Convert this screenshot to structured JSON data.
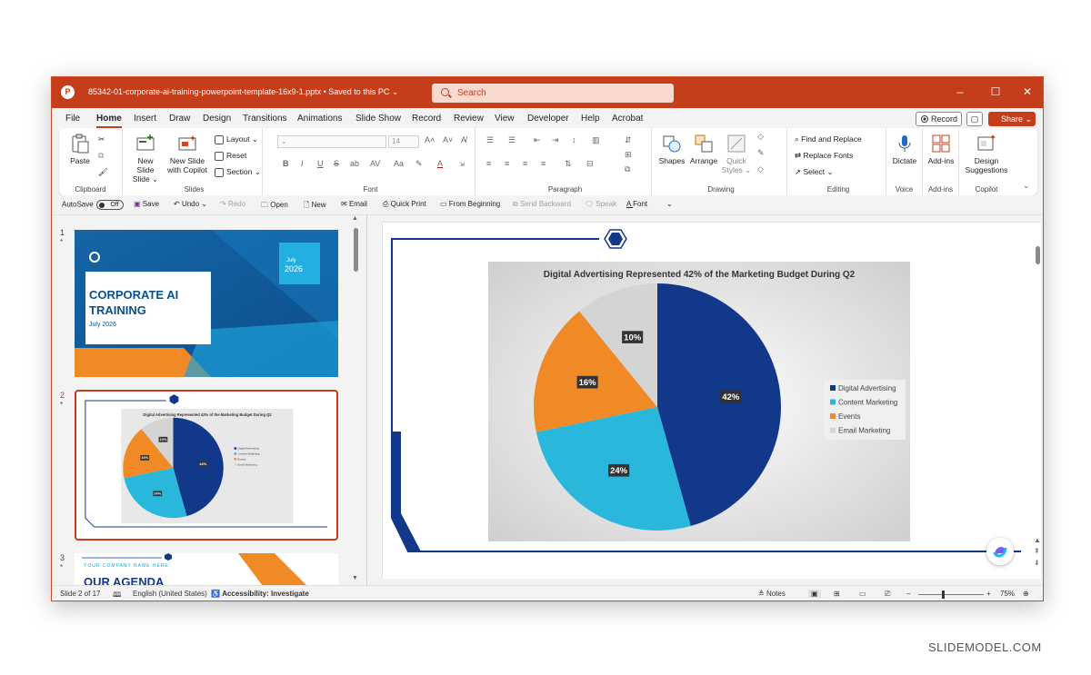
{
  "app": {
    "doc_title": "85342-01-corporate-ai-training-powerpoint-template-16x9-1.pptx • Saved to this PC ⌄",
    "search_placeholder": "Search"
  },
  "menu": {
    "tabs": [
      "File",
      "Home",
      "Insert",
      "Draw",
      "Design",
      "Transitions",
      "Animations",
      "Slide Show",
      "Record",
      "Review",
      "View",
      "Developer",
      "Help",
      "Acrobat"
    ],
    "active": "Home",
    "record_label": "Record",
    "share_label": "Share ⌄"
  },
  "ribbon": {
    "clipboard": {
      "label": "Clipboard",
      "paste": "Paste"
    },
    "slides": {
      "label": "Slides",
      "new_slide": "New Slide",
      "new_slide_copilot_1": "New Slide",
      "new_slide_copilot_2": "with Copilot",
      "layout": "Layout ⌄",
      "reset": "Reset",
      "section": "Section ⌄"
    },
    "font": {
      "label": "Font",
      "size": "14",
      "bold": "B",
      "italic": "I",
      "underline": "U",
      "strike": "S",
      "shadow": "ab",
      "spacing": "AV",
      "case": "Aa",
      "color": "A"
    },
    "paragraph": {
      "label": "Paragraph"
    },
    "drawing": {
      "label": "Drawing",
      "shapes": "Shapes",
      "arrange": "Arrange",
      "quick_styles_1": "Quick",
      "quick_styles_2": "Styles ⌄"
    },
    "editing": {
      "label": "Editing",
      "find_replace": "Find and Replace",
      "replace_fonts": "Replace Fonts",
      "select": "Select ⌄"
    },
    "voice": {
      "label": "Voice",
      "dictate": "Dictate"
    },
    "addins": {
      "label": "Add-ins",
      "addins": "Add-ins"
    },
    "copilot": {
      "label": "Copilot",
      "design_1": "Design",
      "design_2": "Suggestions"
    }
  },
  "qat": {
    "autosave": "AutoSave",
    "autosave_state": "Off",
    "save": "Save",
    "undo": "Undo",
    "redo": "Redo",
    "open": "Open",
    "new": "New",
    "email": "Email",
    "quick_print": "Quick Print",
    "from_beginning": "From Beginning",
    "send_backward": "Send Backward",
    "speak": "Speak",
    "font": "Font"
  },
  "thumbnails": {
    "slide1": {
      "num": "1",
      "title_line1": "CORPORATE AI",
      "title_line2": "TRAINING",
      "date": "July 2026",
      "badge_month": "July",
      "badge_year": "2026"
    },
    "slide2": {
      "num": "2",
      "title": "Digital Advertising Represented 42% of the Marketing Budget During Q2"
    },
    "slide3": {
      "num": "3",
      "company": "YOUR COMPANY NAME HERE",
      "title": "OUR AGENDA"
    }
  },
  "chart_data": {
    "type": "pie",
    "title": "Digital Advertising Represented 42% of the Marketing Budget During Q2",
    "categories": [
      "Digital Advertising",
      "Content Marketing",
      "Events",
      "Email Marketing"
    ],
    "values": [
      42,
      24,
      16,
      10
    ],
    "data_labels": [
      "42%",
      "24%",
      "16%",
      "10%"
    ],
    "colors": [
      "#12388a",
      "#2ab7dc",
      "#f08a27",
      "#d4d4d4"
    ],
    "legend_position": "right"
  },
  "status": {
    "slide": "Slide 2 of 17",
    "language": "English (United States)",
    "accessibility": "Accessibility: Investigate",
    "notes": "Notes",
    "zoom": "75%"
  },
  "watermark": "SLIDEMODEL.COM"
}
